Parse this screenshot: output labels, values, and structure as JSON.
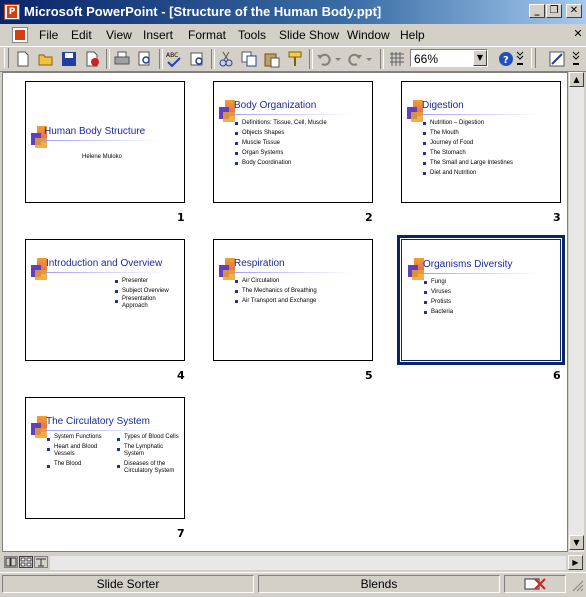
{
  "window": {
    "title": "Microsoft PowerPoint - [Structure of the Human Body.ppt]",
    "buttons": {
      "minimize": "_",
      "restore": "❐",
      "close": "✕"
    }
  },
  "menu": {
    "items": [
      {
        "label": "File"
      },
      {
        "label": "Edit"
      },
      {
        "label": "View"
      },
      {
        "label": "Insert"
      },
      {
        "label": "Format"
      },
      {
        "label": "Tools"
      },
      {
        "label": "Slide Show"
      },
      {
        "label": "Window"
      },
      {
        "label": "Help"
      }
    ],
    "close_doc": "✕"
  },
  "toolbar": {
    "zoom": "66%",
    "icons": [
      "new-icon",
      "open-icon",
      "save-icon",
      "permission-icon",
      "print-icon",
      "print-preview-icon",
      "spelling-icon",
      "research-icon",
      "cut-icon",
      "copy-icon",
      "paste-icon",
      "format-painter-icon",
      "undo-icon",
      "redo-icon",
      "show-grid-icon",
      "zoom-dropdown",
      "help-icon"
    ]
  },
  "slides": [
    {
      "number": "1",
      "title": "Human Body Structure",
      "subtitle": "Helene Muloko",
      "bullets": []
    },
    {
      "number": "2",
      "title": "Body Organization",
      "bullets": [
        "Definitions: Tissue, Cell, Muscle",
        "Objects Shapes",
        "Muscle Tissue",
        "Organ Systems",
        "Body Coordination"
      ]
    },
    {
      "number": "3",
      "title": "Digestion",
      "bullets": [
        "Nutrition – Digestion",
        "The Mouth",
        "Journey of Food",
        "The Stomach",
        "The Small and Large Intestines",
        "Diet and Nutrition"
      ]
    },
    {
      "number": "4",
      "title": "Introduction and Overview",
      "bullets": [
        "Presenter",
        "Subject Overview",
        "Presentation Approach"
      ]
    },
    {
      "number": "5",
      "title": "Respiration",
      "bullets": [
        "Air Circulation",
        "The Mechanics of Breathing",
        "Air Transport and Exchange"
      ]
    },
    {
      "number": "6",
      "title": "Organisms Diversity",
      "bullets": [
        "Fungi",
        "Viruses",
        "Protists",
        "Bacteria"
      ]
    },
    {
      "number": "7",
      "title": "The Circulatory System",
      "bullets_left": [
        "System Functions",
        "Heart and Blood Vessels",
        "The Blood"
      ],
      "bullets_right": [
        "Types of Blood Cells",
        "The Lymphatic System",
        "Diseases of the Circulatory System"
      ]
    }
  ],
  "status": {
    "view": "Slide Sorter",
    "design": "Blends"
  },
  "colors": {
    "titlebar_start": "#0a246a",
    "slide_title": "#1a2a9a",
    "selection": "#0a246a"
  }
}
